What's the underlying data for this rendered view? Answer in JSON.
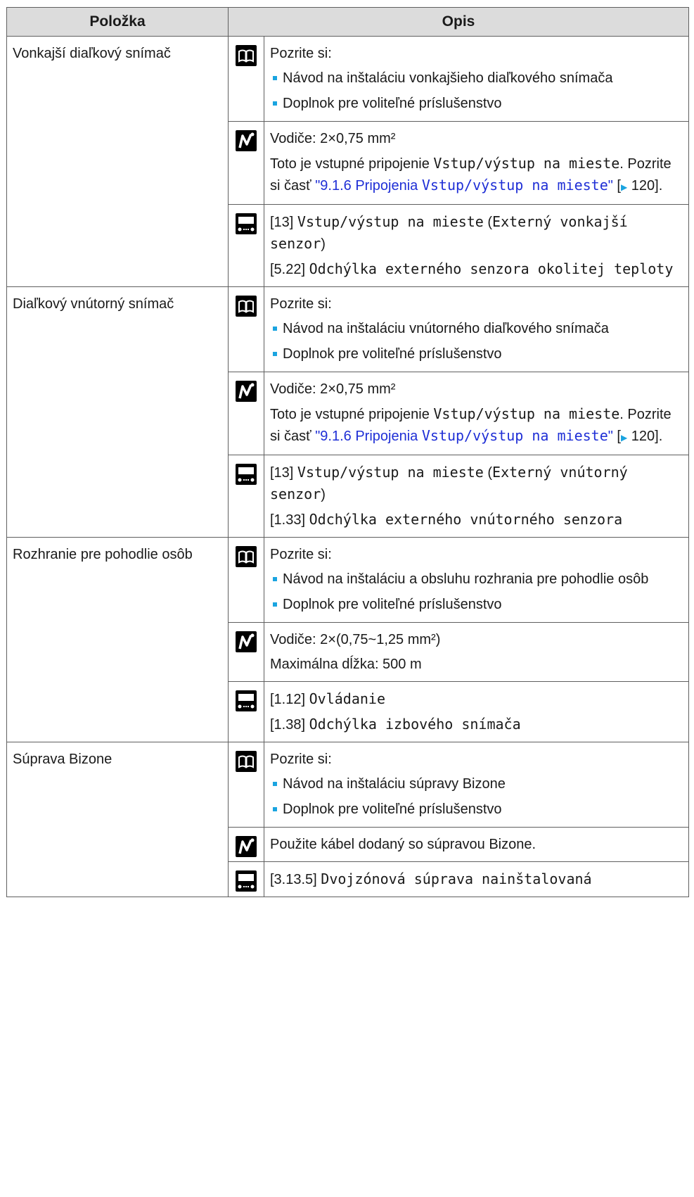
{
  "header": {
    "col1": "Položka",
    "col2": "Opis"
  },
  "common": {
    "see": "Pozrite si:",
    "optional": "Doplnok pre voliteľné príslušenstvo",
    "wires_075": "Vodiče: 2×0,75 mm²",
    "field_io": "Vstup/výstup na mieste",
    "link_section": "\"9.1.6 Pripojenia ",
    "link_end": "\"",
    "page_ref": "120",
    "bracket_open": " [",
    "bracket_close": "].",
    "intro": "Toto je vstupné pripojenie ",
    "refer": ". Pozrite si časť "
  },
  "icons": {
    "book": "book-icon",
    "wire": "wire-icon",
    "controller": "controller-icon",
    "arrow": "arrow-right-icon"
  },
  "rows": [
    {
      "item": "Vonkajší diaľkový snímač",
      "manual": "Návod na inštaláciu vonkajšieho diaľkového snímača",
      "code1": "[13]",
      "text1": "Vstup/výstup na mieste",
      "paren1": "Externý vonkajší senzor",
      "code2": "[5.22]",
      "text2": "Odchýlka externého senzora okolitej teploty"
    },
    {
      "item": "Diaľkový vnútorný snímač",
      "manual": "Návod na inštaláciu vnútorného diaľkového snímača",
      "code1": "[13]",
      "text1": "Vstup/výstup na mieste",
      "paren1": "Externý vnútorný senzor",
      "code2": "[1.33]",
      "text2": "Odchýlka externého vnútorného senzora"
    },
    {
      "item": "Rozhranie pre pohodlie osôb",
      "manual": "Návod na inštaláciu a obsluhu rozhrania pre pohodlie osôb",
      "wires": "Vodiče: 2×(0,75~1,25 mm²)",
      "maxlen": "Maximálna dĺžka: 500 m",
      "code1": "[1.12]",
      "text1": "Ovládanie",
      "code2": "[1.38]",
      "text2": "Odchýlka izbového snímača"
    },
    {
      "item": "Súprava Bizone",
      "manual": "Návod na inštaláciu súpravy Bizone",
      "cable": "Použite kábel dodaný so súpravou Bizone.",
      "code1": "[3.13.5]",
      "text1": "Dvojzónová súprava nainštalovaná"
    }
  ]
}
